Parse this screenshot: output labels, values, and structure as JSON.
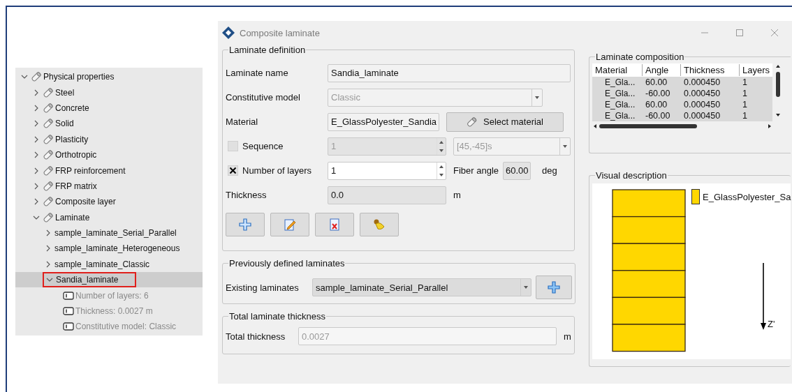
{
  "tree": {
    "children": [
      {
        "label": "Physical properties",
        "kind": "material",
        "expanded": true,
        "selected": false,
        "children": [
          {
            "label": "Steel",
            "kind": "material",
            "expanded": false,
            "selected": false
          },
          {
            "label": "Concrete",
            "kind": "material",
            "expanded": false,
            "selected": false
          },
          {
            "label": "Solid",
            "kind": "material",
            "expanded": false,
            "selected": false
          },
          {
            "label": "Plasticity",
            "kind": "material",
            "expanded": false,
            "selected": false
          },
          {
            "label": "Orthotropic",
            "kind": "material",
            "expanded": false,
            "selected": false
          },
          {
            "label": "FRP reinforcement",
            "kind": "material",
            "expanded": false,
            "selected": false
          },
          {
            "label": "FRP matrix",
            "kind": "material",
            "expanded": false,
            "selected": false
          },
          {
            "label": "Composite layer",
            "kind": "material",
            "expanded": false,
            "selected": false
          },
          {
            "label": "Laminate",
            "kind": "material",
            "expanded": true,
            "selected": false,
            "children": [
              {
                "label": "sample_laminate_Serial_Parallel",
                "kind": "laminate",
                "expanded": false,
                "selected": false
              },
              {
                "label": "sample_laminate_Heterogeneous",
                "kind": "laminate",
                "expanded": false,
                "selected": false
              },
              {
                "label": "sample_laminate_Classic",
                "kind": "laminate",
                "expanded": false,
                "selected": false
              },
              {
                "label": "Sandia_laminate",
                "kind": "laminate",
                "expanded": true,
                "selected": true,
                "annotated": true,
                "children": [
                  {
                    "label": "Number of layers: 6",
                    "kind": "property",
                    "disabled": true
                  },
                  {
                    "label": "Thickness: 0.0027 m",
                    "kind": "property",
                    "disabled": true
                  },
                  {
                    "label": "Constitutive model: Classic",
                    "kind": "property",
                    "disabled": true
                  }
                ]
              }
            ]
          }
        ]
      }
    ]
  },
  "dialog": {
    "title": "Composite laminate"
  },
  "laminate_definition": {
    "title": "Laminate definition",
    "laminate_name": {
      "label": "Laminate name",
      "value": "Sandia_laminate"
    },
    "constitutive_model": {
      "label": "Constitutive model",
      "value": "Classic",
      "disabled": true
    },
    "material": {
      "label": "Material",
      "value": "E_GlassPolyester_Sandia",
      "button": "Select material"
    },
    "sequence": {
      "label": "Sequence",
      "checked": false,
      "value": "1",
      "pattern": "[45,-45]s"
    },
    "number_of_layers": {
      "label": "Number of layers",
      "checked": true,
      "value": "1"
    },
    "fiber_angle": {
      "label": "Fiber angle",
      "value": "60.00",
      "unit": "deg"
    },
    "thickness": {
      "label": "Thickness",
      "value": "0.0",
      "unit": "m"
    },
    "buttons": [
      {
        "kind": "add"
      },
      {
        "kind": "edit"
      },
      {
        "kind": "delete"
      },
      {
        "kind": "clear"
      }
    ]
  },
  "previously_defined": {
    "title": "Previously defined laminates",
    "label": "Existing laminates",
    "value": "sample_laminate_Serial_Parallel"
  },
  "total_thickness": {
    "title": "Total laminate thickness",
    "label": "Total thickness",
    "value": "0.0027",
    "unit": "m"
  },
  "laminate_composition": {
    "title": "Laminate composition",
    "columns": [
      "Material",
      "Angle",
      "Thickness",
      "Layers"
    ],
    "rows": [
      {
        "cells": [
          "E_Gla...",
          "60.00",
          "0.000450",
          "1"
        ],
        "selected": true
      },
      {
        "cells": [
          "E_Gla...",
          "-60.00",
          "0.000450",
          "1"
        ],
        "selected": true
      },
      {
        "cells": [
          "E_Gla...",
          "60.00",
          "0.000450",
          "1"
        ],
        "selected": true
      },
      {
        "cells": [
          "E_Gla...",
          "-60.00",
          "0.000450",
          "1"
        ],
        "selected": true
      }
    ]
  },
  "visual_description": {
    "title": "Visual description",
    "legend": "E_GlassPolyester_Sa",
    "axis_label": "Z'"
  }
}
